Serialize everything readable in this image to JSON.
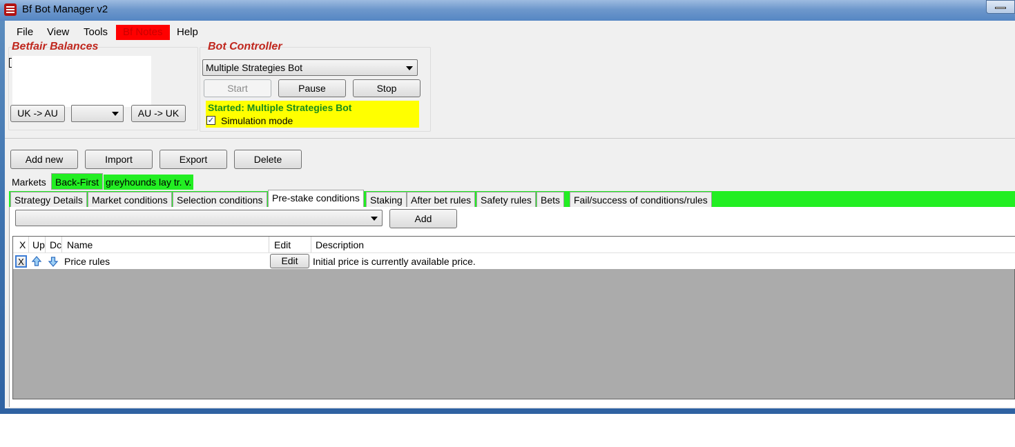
{
  "window": {
    "title": "Bf Bot Manager v2"
  },
  "menu": {
    "items": [
      "File",
      "View",
      "Tools",
      "Bf Notes",
      "Help"
    ]
  },
  "balances": {
    "title": "Betfair Balances",
    "uk_to_au": "UK -> AU",
    "au_to_uk": "AU -> UK",
    "currency_selected": ""
  },
  "bot_controller": {
    "title": "Bot Controller",
    "bot_selected": "Multiple Strategies Bot",
    "start": "Start",
    "pause": "Pause",
    "stop": "Stop",
    "status": "Started: Multiple Strategies Bot",
    "simulation_label": "Simulation mode",
    "simulation_checked": true
  },
  "strategy_actions": {
    "add_new": "Add new",
    "import": "Import",
    "export": "Export",
    "delete": "Delete"
  },
  "strategy_tabs": {
    "markets": "Markets",
    "back_first": "Back-First",
    "greyhounds": "greyhounds lay tr. v."
  },
  "detail_tabs": [
    "Strategy Details",
    "Market conditions",
    "Selection conditions",
    "Pre-stake conditions",
    "Staking",
    "After bet rules",
    "Safety rules",
    "Bets",
    "Fail/success of conditions/rules"
  ],
  "active_detail_tab": "Pre-stake conditions",
  "condition_picker": {
    "selected": "",
    "add": "Add"
  },
  "grid": {
    "columns": {
      "x": "X",
      "up": "Up",
      "down": "Dc",
      "name": "Name",
      "edit": "Edit",
      "description": "Description"
    },
    "rows": [
      {
        "x": "X",
        "name": "Price rules",
        "edit": "Edit",
        "description": "Initial price is currently available price."
      }
    ]
  },
  "colors": {
    "accent_green": "#22ee22",
    "status_yellow": "#ffff00",
    "title_red": "#c0271e"
  }
}
